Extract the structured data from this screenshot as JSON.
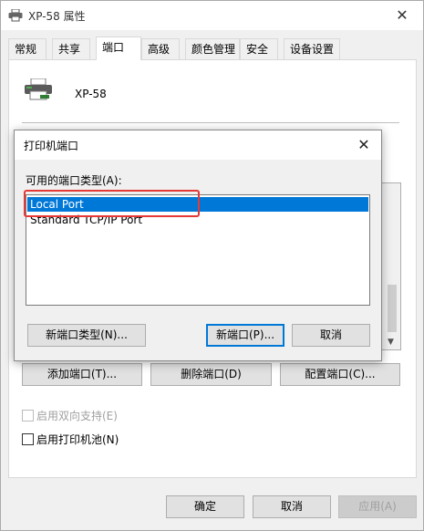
{
  "window": {
    "title": "XP-58 属性",
    "close_glyph": "✕"
  },
  "tabs": [
    {
      "label": "常规"
    },
    {
      "label": "共享"
    },
    {
      "label": "端口"
    },
    {
      "label": "高级"
    },
    {
      "label": "颜色管理"
    },
    {
      "label": "安全"
    },
    {
      "label": "设备设置"
    }
  ],
  "printer": {
    "name": "XP-58"
  },
  "port_buttons": {
    "add": "添加端口(T)...",
    "delete": "删除端口(D)",
    "configure": "配置端口(C)..."
  },
  "checkboxes": {
    "bidirectional": "启用双向支持(E)",
    "pooling": "启用打印机池(N)"
  },
  "footer": {
    "ok": "确定",
    "cancel": "取消",
    "apply": "应用(A)"
  },
  "dialog": {
    "title": "打印机端口",
    "close_glyph": "✕",
    "label": "可用的端口类型(A):",
    "items": [
      {
        "label": "Local Port"
      },
      {
        "label": "Standard TCP/IP Port"
      }
    ],
    "selected_index": 0,
    "new_port_type": "新端口类型(N)...",
    "new_port": "新端口(P)...",
    "cancel": "取消"
  },
  "colors": {
    "selection": "#0078d7",
    "highlight_box": "#e53935"
  }
}
